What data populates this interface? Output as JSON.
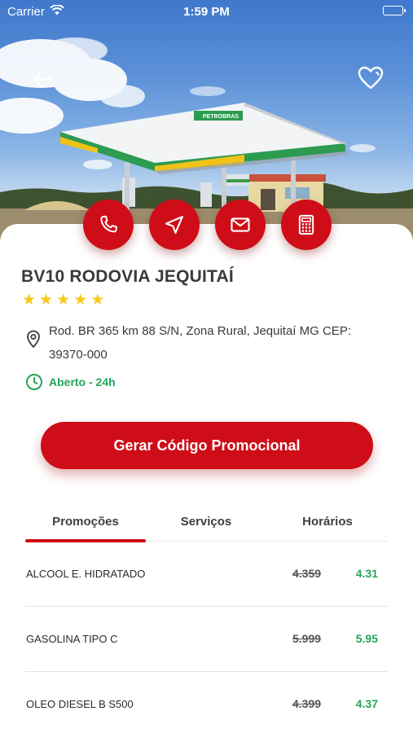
{
  "status_bar": {
    "carrier": "Carrier",
    "time": "1:59 PM"
  },
  "station": {
    "name": "BV10 RODOVIA JEQUITAÍ",
    "rating": 5,
    "stars": [
      "★",
      "★",
      "★",
      "★",
      "★"
    ],
    "address": "Rod. BR 365 km 88 S/N, Zona Rural, Jequitaí MG CEP: 39370-000",
    "hours": "Aberto - 24h",
    "canopy_brand": "PETROBRAS"
  },
  "actions": [
    {
      "name": "call",
      "icon": "phone-icon"
    },
    {
      "name": "route",
      "icon": "navigation-icon"
    },
    {
      "name": "email",
      "icon": "mail-icon"
    },
    {
      "name": "calculator",
      "icon": "calculator-icon"
    }
  ],
  "promo_button": "Gerar Código Promocional",
  "tabs": [
    {
      "label": "Promoções",
      "active": true
    },
    {
      "label": "Serviços",
      "active": false
    },
    {
      "label": "Horários",
      "active": false
    }
  ],
  "fuels": [
    {
      "name": "ALCOOL E. HIDRATADO",
      "old_price": "4.359",
      "new_price": "4.31"
    },
    {
      "name": "GASOLINA TIPO C",
      "old_price": "5.999",
      "new_price": "5.95"
    },
    {
      "name": "OLEO DIESEL B S500",
      "old_price": "4.399",
      "new_price": "4.37"
    }
  ],
  "colors": {
    "accent": "#cf0d18",
    "open": "#23a55a",
    "star": "#f7c91a"
  }
}
